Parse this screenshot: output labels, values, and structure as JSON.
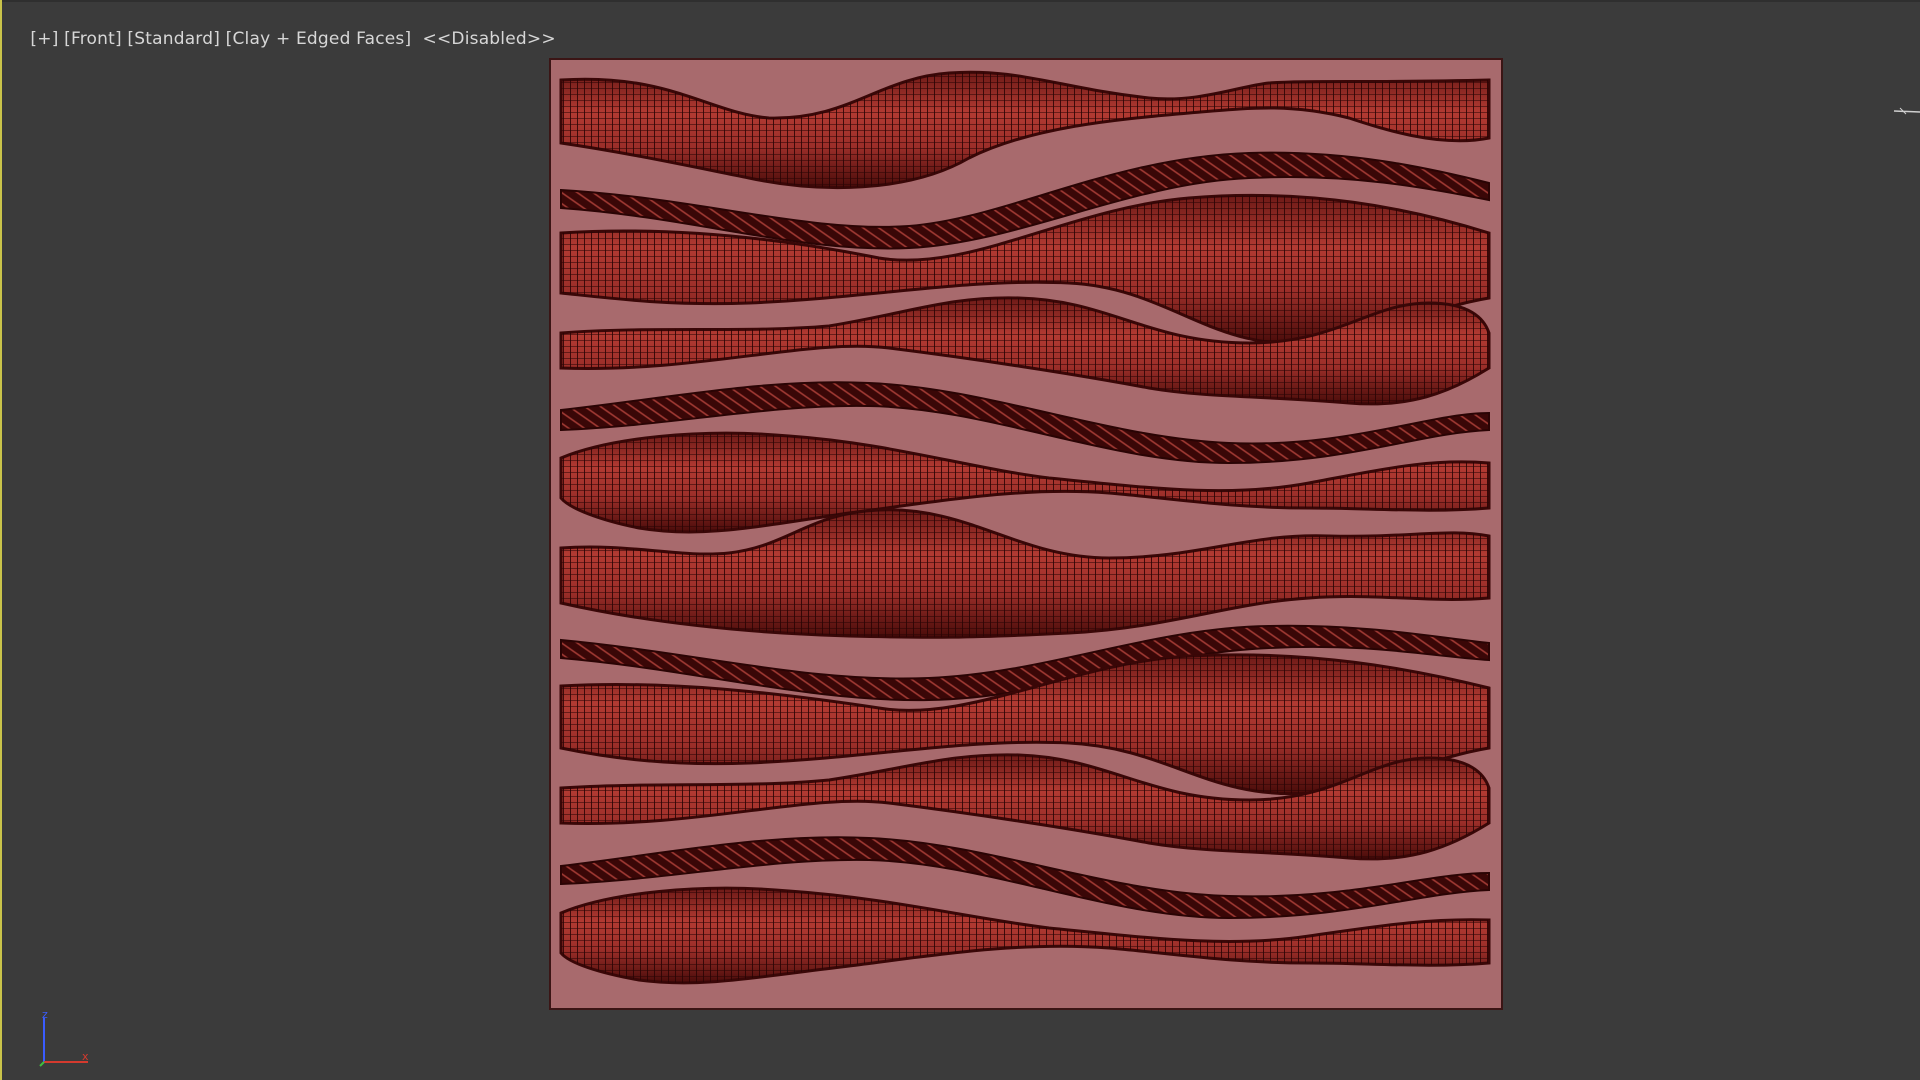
{
  "viewport": {
    "label_parts": [
      "[+]",
      "[Front]",
      "[Standard]",
      "[Clay + Edged Faces]",
      "<<Disabled>>"
    ],
    "border_color": "#c9c34a",
    "background": "#3b3b3b"
  },
  "scene": {
    "panel_color": "#a86a6d",
    "ribbon_color": "#8e2a26",
    "ribbon_dark": "#3a0707",
    "wire_color": "#2a0404"
  },
  "axis_gizmo": {
    "z_label": "z",
    "x_label": "x",
    "z_color": "#3a5cff",
    "x_color": "#d43a2e",
    "y_color": "#3fbf3f"
  },
  "icons": {
    "axis": "axis-tripod-icon",
    "edge": "viewcube-edge-icon"
  }
}
